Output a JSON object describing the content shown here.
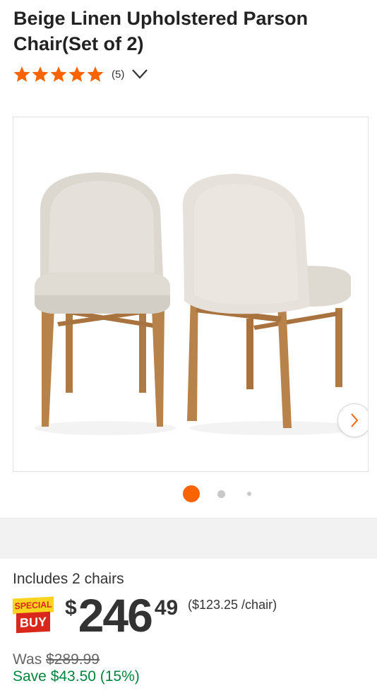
{
  "product": {
    "title": "Beige Linen Upholstered Parson Chair(Set of 2)",
    "rating": 5,
    "review_count": "(5)",
    "star_icon": "star-icon",
    "expand_icon": "chevron-down-icon"
  },
  "gallery": {
    "next_icon": "chevron-right-icon",
    "image_count": 3,
    "active_index": 0
  },
  "pricing": {
    "includes": "Includes 2 chairs",
    "badge_top": "SPECIAL",
    "badge_bottom": "BUY",
    "currency": "$",
    "dollars": "246",
    "cents": "49",
    "unit_price": "($123.25 /chair)",
    "was_label": "Was ",
    "was_price": "$289.99",
    "save_text": "Save $43.50 (15%)"
  },
  "colors": {
    "accent": "#f96302",
    "save_green": "#00853e",
    "badge_yellow": "#fbd420",
    "badge_red": "#d9281b"
  }
}
